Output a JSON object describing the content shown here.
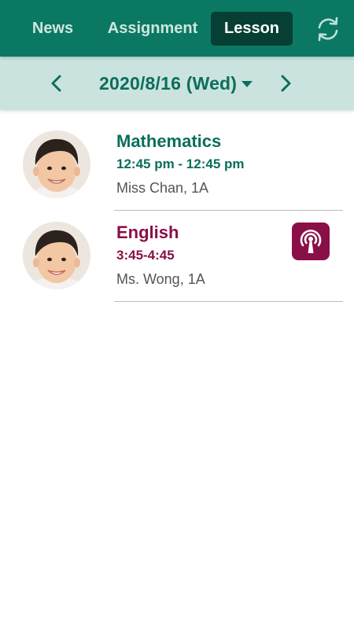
{
  "tabs": [
    {
      "label": "News",
      "active": false
    },
    {
      "label": "Assignment",
      "active": false
    },
    {
      "label": "Lesson",
      "active": true
    }
  ],
  "header": {
    "refresh_icon": "refresh-icon",
    "color": "#0b7863",
    "active_tab_color": "#073f35"
  },
  "date_nav": {
    "date": "2020/8/16 (Wed)",
    "prev_icon": "chevron-left-icon",
    "next_icon": "chevron-right-icon",
    "dropdown_icon": "caret-down-icon",
    "background": "#cbe3de"
  },
  "lessons": [
    {
      "subject": "Mathematics",
      "time": "12:45 pm - 12:45 pm",
      "teacher": "Miss Chan, 1A",
      "color": "#0b6e5c",
      "live": false
    },
    {
      "subject": "English",
      "time": "3:45-4:45",
      "teacher": "Ms. Wong, 1A",
      "color": "#8b0f47",
      "live": true,
      "live_icon": "broadcast-icon"
    }
  ]
}
